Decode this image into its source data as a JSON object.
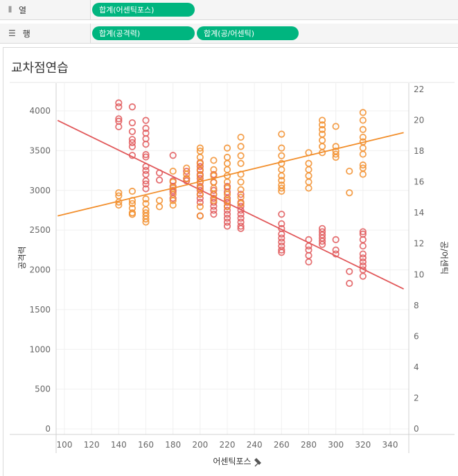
{
  "shelves": {
    "columns": {
      "icon": "columns-icon",
      "label": "열",
      "pills": [
        "합계(어센틱포스)"
      ]
    },
    "rows": {
      "icon": "rows-icon",
      "label": "행",
      "pills": [
        "합계(공격력)",
        "합계(공/어센틱)"
      ]
    }
  },
  "sheet": {
    "title": "교차점연습"
  },
  "colors": {
    "pill": "#00b57f",
    "attack": "#e15759",
    "ratio": "#f28e2b"
  },
  "chart_data": {
    "type": "scatter",
    "title": "교차점연습",
    "xlabel": "어센틱포스",
    "ylabel": "공격력",
    "y2label": "공/어센틱",
    "xlim": [
      95,
      350
    ],
    "ylim": [
      0,
      4200
    ],
    "y2lim": [
      0,
      22
    ],
    "x_ticks": [
      100,
      120,
      140,
      160,
      180,
      200,
      220,
      240,
      260,
      280,
      300,
      320,
      340
    ],
    "y_ticks": [
      0,
      500,
      1000,
      1500,
      2000,
      2500,
      3000,
      3500,
      4000
    ],
    "y2_ticks": [
      0,
      2,
      4,
      6,
      8,
      10,
      12,
      14,
      16,
      18,
      20,
      22
    ],
    "grid": true,
    "series": [
      {
        "axis": "left",
        "points": [
          [
            140,
            4100
          ],
          [
            140,
            4050
          ],
          [
            140,
            3900
          ],
          [
            140,
            3870
          ],
          [
            140,
            3800
          ],
          [
            150,
            4050
          ],
          [
            150,
            3850
          ],
          [
            150,
            3740
          ],
          [
            150,
            3640
          ],
          [
            150,
            3600
          ],
          [
            150,
            3550
          ],
          [
            150,
            3440
          ],
          [
            160,
            3880
          ],
          [
            160,
            3780
          ],
          [
            160,
            3720
          ],
          [
            160,
            3650
          ],
          [
            160,
            3580
          ],
          [
            160,
            3450
          ],
          [
            160,
            3420
          ],
          [
            160,
            3300
          ],
          [
            160,
            3250
          ],
          [
            160,
            3200
          ],
          [
            160,
            3120
          ],
          [
            160,
            3080
          ],
          [
            160,
            3020
          ],
          [
            170,
            3220
          ],
          [
            170,
            3130
          ],
          [
            180,
            3440
          ],
          [
            180,
            3120
          ],
          [
            180,
            3050
          ],
          [
            180,
            3000
          ],
          [
            180,
            2980
          ],
          [
            180,
            2900
          ],
          [
            190,
            3240
          ],
          [
            190,
            3150
          ],
          [
            190,
            3120
          ],
          [
            200,
            3350
          ],
          [
            200,
            3300
          ],
          [
            200,
            3250
          ],
          [
            200,
            3200
          ],
          [
            200,
            3150
          ],
          [
            200,
            3100
          ],
          [
            200,
            3050
          ],
          [
            200,
            3000
          ],
          [
            200,
            2950
          ],
          [
            200,
            2900
          ],
          [
            200,
            2850
          ],
          [
            200,
            2680
          ],
          [
            210,
            3200
          ],
          [
            210,
            3100
          ],
          [
            210,
            3000
          ],
          [
            210,
            2950
          ],
          [
            210,
            2900
          ],
          [
            210,
            2850
          ],
          [
            210,
            2800
          ],
          [
            210,
            2750
          ],
          [
            210,
            2700
          ],
          [
            220,
            3050
          ],
          [
            220,
            2980
          ],
          [
            220,
            2900
          ],
          [
            220,
            2850
          ],
          [
            220,
            2800
          ],
          [
            220,
            2750
          ],
          [
            220,
            2700
          ],
          [
            220,
            2650
          ],
          [
            220,
            2600
          ],
          [
            220,
            2550
          ],
          [
            230,
            2950
          ],
          [
            230,
            2850
          ],
          [
            230,
            2800
          ],
          [
            230,
            2750
          ],
          [
            230,
            2700
          ],
          [
            230,
            2650
          ],
          [
            230,
            2600
          ],
          [
            230,
            2550
          ],
          [
            230,
            2520
          ],
          [
            260,
            2700
          ],
          [
            260,
            2580
          ],
          [
            260,
            2520
          ],
          [
            260,
            2450
          ],
          [
            260,
            2400
          ],
          [
            260,
            2350
          ],
          [
            260,
            2300
          ],
          [
            260,
            2250
          ],
          [
            260,
            2220
          ],
          [
            280,
            2380
          ],
          [
            280,
            2300
          ],
          [
            280,
            2250
          ],
          [
            280,
            2180
          ],
          [
            280,
            2100
          ],
          [
            290,
            2520
          ],
          [
            290,
            2480
          ],
          [
            290,
            2440
          ],
          [
            290,
            2400
          ],
          [
            290,
            2360
          ],
          [
            290,
            2320
          ],
          [
            300,
            2380
          ],
          [
            300,
            2250
          ],
          [
            300,
            2200
          ],
          [
            310,
            1980
          ],
          [
            310,
            1830
          ],
          [
            320,
            2480
          ],
          [
            320,
            2450
          ],
          [
            320,
            2380
          ],
          [
            320,
            2300
          ],
          [
            320,
            2200
          ],
          [
            320,
            2150
          ],
          [
            320,
            2100
          ],
          [
            320,
            2050
          ],
          [
            320,
            2000
          ],
          [
            320,
            1920
          ]
        ],
        "trend": [
          [
            95,
            3880
          ],
          [
            350,
            1760
          ]
        ]
      },
      {
        "axis": "right",
        "points": [
          [
            140,
            15.3
          ],
          [
            140,
            15.1
          ],
          [
            140,
            14.7
          ],
          [
            140,
            14.5
          ],
          [
            150,
            15.4
          ],
          [
            150,
            14.8
          ],
          [
            150,
            14.6
          ],
          [
            150,
            14.3
          ],
          [
            150,
            14.0
          ],
          [
            150,
            13.9
          ],
          [
            160,
            14.9
          ],
          [
            160,
            14.6
          ],
          [
            160,
            14.2
          ],
          [
            160,
            14.0
          ],
          [
            160,
            13.8
          ],
          [
            160,
            13.6
          ],
          [
            160,
            13.4
          ],
          [
            170,
            14.8
          ],
          [
            170,
            14.4
          ],
          [
            180,
            16.7
          ],
          [
            180,
            16.0
          ],
          [
            180,
            15.6
          ],
          [
            180,
            15.2
          ],
          [
            180,
            14.8
          ],
          [
            180,
            14.5
          ],
          [
            190,
            16.9
          ],
          [
            190,
            16.5
          ],
          [
            190,
            16.2
          ],
          [
            200,
            18.2
          ],
          [
            200,
            18.0
          ],
          [
            200,
            17.6
          ],
          [
            200,
            17.2
          ],
          [
            200,
            16.8
          ],
          [
            200,
            16.4
          ],
          [
            200,
            16.0
          ],
          [
            200,
            15.6
          ],
          [
            200,
            15.2
          ],
          [
            200,
            14.4
          ],
          [
            200,
            13.8
          ],
          [
            210,
            17.4
          ],
          [
            210,
            16.8
          ],
          [
            210,
            16.4
          ],
          [
            210,
            16.0
          ],
          [
            210,
            15.6
          ],
          [
            210,
            15.2
          ],
          [
            210,
            14.8
          ],
          [
            220,
            18.2
          ],
          [
            220,
            17.6
          ],
          [
            220,
            17.2
          ],
          [
            220,
            16.8
          ],
          [
            220,
            16.4
          ],
          [
            220,
            16.0
          ],
          [
            220,
            15.6
          ],
          [
            220,
            15.2
          ],
          [
            220,
            14.8
          ],
          [
            220,
            14.4
          ],
          [
            230,
            18.9
          ],
          [
            230,
            18.3
          ],
          [
            230,
            17.7
          ],
          [
            230,
            17.2
          ],
          [
            230,
            16.5
          ],
          [
            230,
            16.0
          ],
          [
            230,
            15.5
          ],
          [
            230,
            15.0
          ],
          [
            230,
            14.6
          ],
          [
            260,
            19.1
          ],
          [
            260,
            18.2
          ],
          [
            260,
            17.7
          ],
          [
            260,
            17.2
          ],
          [
            260,
            16.8
          ],
          [
            260,
            16.4
          ],
          [
            260,
            16.1
          ],
          [
            260,
            15.8
          ],
          [
            260,
            15.6
          ],
          [
            260,
            15.4
          ],
          [
            280,
            17.9
          ],
          [
            280,
            17.2
          ],
          [
            280,
            16.8
          ],
          [
            280,
            16.4
          ],
          [
            280,
            16.0
          ],
          [
            280,
            15.6
          ],
          [
            290,
            20.0
          ],
          [
            290,
            19.7
          ],
          [
            290,
            19.4
          ],
          [
            290,
            19.1
          ],
          [
            290,
            18.7
          ],
          [
            290,
            18.3
          ],
          [
            290,
            17.9
          ],
          [
            300,
            19.6
          ],
          [
            300,
            18.3
          ],
          [
            300,
            18.0
          ],
          [
            300,
            17.8
          ],
          [
            300,
            17.6
          ],
          [
            310,
            16.7
          ],
          [
            310,
            15.3
          ],
          [
            320,
            20.5
          ],
          [
            320,
            20.0
          ],
          [
            320,
            19.4
          ],
          [
            320,
            18.9
          ],
          [
            320,
            18.6
          ],
          [
            320,
            18.2
          ],
          [
            320,
            17.8
          ],
          [
            320,
            17.1
          ],
          [
            320,
            16.9
          ],
          [
            320,
            16.5
          ]
        ],
        "trend": [
          [
            95,
            13.8
          ],
          [
            350,
            19.2
          ]
        ]
      }
    ]
  }
}
